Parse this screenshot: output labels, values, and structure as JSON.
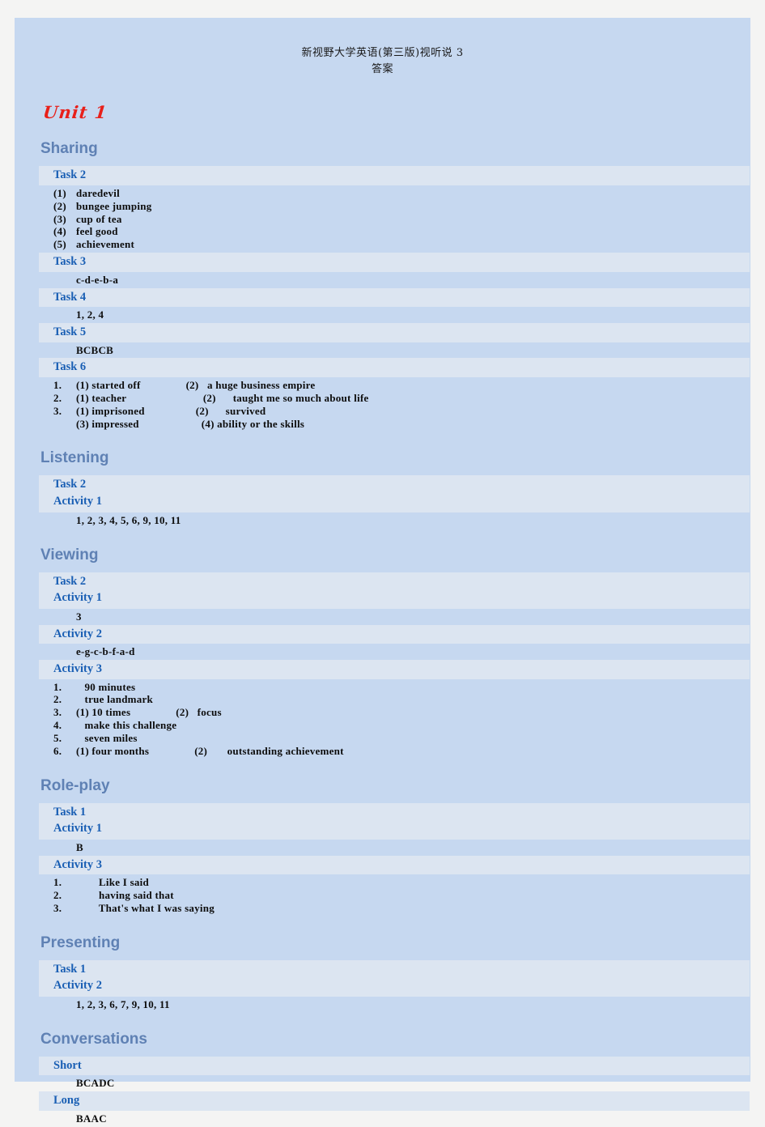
{
  "document": {
    "title_line1": "新视野大学英语(第三版)视听说 3",
    "title_line2": "答案",
    "unit": "Unit 1"
  },
  "colors": {
    "page_background": "#f4f4f3",
    "panel_background": "#c6d8f0",
    "bar_background": "#dce5f1",
    "section_heading": "#5f81b4",
    "task_label": "#1a5fb4",
    "unit_heading": "#e8201a",
    "body_text": "#0d0d0d"
  },
  "sections": [
    {
      "heading": "Sharing",
      "blocks": [
        {
          "labels": [
            "Task 2"
          ],
          "lines": [
            {
              "num": "(1)",
              "a": "daredevil",
              "b": ""
            },
            {
              "num": "(2)",
              "a": "bungee jumping",
              "b": ""
            },
            {
              "num": "(3)",
              "a": "cup of tea",
              "b": ""
            },
            {
              "num": "(4)",
              "a": "feel good",
              "b": ""
            },
            {
              "num": "(5)",
              "a": "achievement",
              "b": ""
            }
          ]
        },
        {
          "labels": [
            "Task 3"
          ],
          "lines": [
            {
              "num": "",
              "a": "c-d-e-b-a",
              "b": ""
            }
          ]
        },
        {
          "labels": [
            "Task 4"
          ],
          "lines": [
            {
              "num": "",
              "a": "1, 2, 4",
              "b": ""
            }
          ]
        },
        {
          "labels": [
            "Task 5"
          ],
          "lines": [
            {
              "num": "",
              "a": "BCBCB",
              "b": ""
            }
          ]
        },
        {
          "labels": [
            "Task 6"
          ],
          "lines": [
            {
              "num": "1.",
              "a": "(1) started off",
              "b": "(2)   a huge business empire"
            },
            {
              "num": "2.",
              "a": "(1) teacher",
              "b": "           (2)      taught me so much about life"
            },
            {
              "num": "3.",
              "a": "(1) imprisoned",
              "b": "  (2)      survived"
            },
            {
              "num": "",
              "a": "(3) impressed",
              "b": "      (4) ability or the skills"
            }
          ]
        }
      ]
    },
    {
      "heading": "Listening",
      "blocks": [
        {
          "labels": [
            "Task 2",
            "Activity 1"
          ],
          "lines": [
            {
              "num": "",
              "a": "1, 2, 3, 4, 5, 6, 9, 10, 11",
              "b": ""
            }
          ]
        }
      ]
    },
    {
      "heading": "Viewing",
      "blocks": [
        {
          "labels": [
            "Task 2",
            "Activity 1"
          ],
          "lines": [
            {
              "num": "",
              "a": "3",
              "b": ""
            }
          ]
        },
        {
          "labels": [
            "Activity 2"
          ],
          "lines": [
            {
              "num": "",
              "a": "e-g-c-b-f-a-d",
              "b": ""
            }
          ]
        },
        {
          "labels": [
            "Activity 3"
          ],
          "lines": [
            {
              "num": "1.",
              "a": "   90 minutes",
              "b": ""
            },
            {
              "num": "2.",
              "a": "   true landmark",
              "b": ""
            },
            {
              "num": "3.",
              "a": "(1) 10 times",
              "b": "(2)   focus"
            },
            {
              "num": "4.",
              "a": "   make this challenge",
              "b": ""
            },
            {
              "num": "5.",
              "a": "   seven miles",
              "b": ""
            },
            {
              "num": "6.",
              "a": "(1) four months",
              "b": "(2)       outstanding achievement"
            }
          ]
        }
      ]
    },
    {
      "heading": "Role-play",
      "blocks": [
        {
          "labels": [
            "Task 1",
            "Activity 1"
          ],
          "lines": [
            {
              "num": "",
              "a": "B",
              "b": ""
            }
          ]
        },
        {
          "labels": [
            "Activity 3"
          ],
          "lines": [
            {
              "num": "1.",
              "a": "        Like I said",
              "b": ""
            },
            {
              "num": "2.",
              "a": "        having said that",
              "b": ""
            },
            {
              "num": "3.",
              "a": "        That's what I was saying",
              "b": ""
            }
          ]
        }
      ]
    },
    {
      "heading": "Presenting",
      "blocks": [
        {
          "labels": [
            "Task 1",
            "Activity 2"
          ],
          "lines": [
            {
              "num": "",
              "a": "1, 2, 3, 6, 7, 9, 10, 11",
              "b": ""
            }
          ]
        }
      ]
    },
    {
      "heading": "Conversations",
      "blocks": [
        {
          "labels": [
            "Short"
          ],
          "lines": [
            {
              "num": "",
              "a": "BCADC",
              "b": ""
            }
          ]
        },
        {
          "labels": [
            "Long"
          ],
          "lines": [
            {
              "num": "",
              "a": "BAAC",
              "b": ""
            }
          ]
        }
      ]
    }
  ]
}
